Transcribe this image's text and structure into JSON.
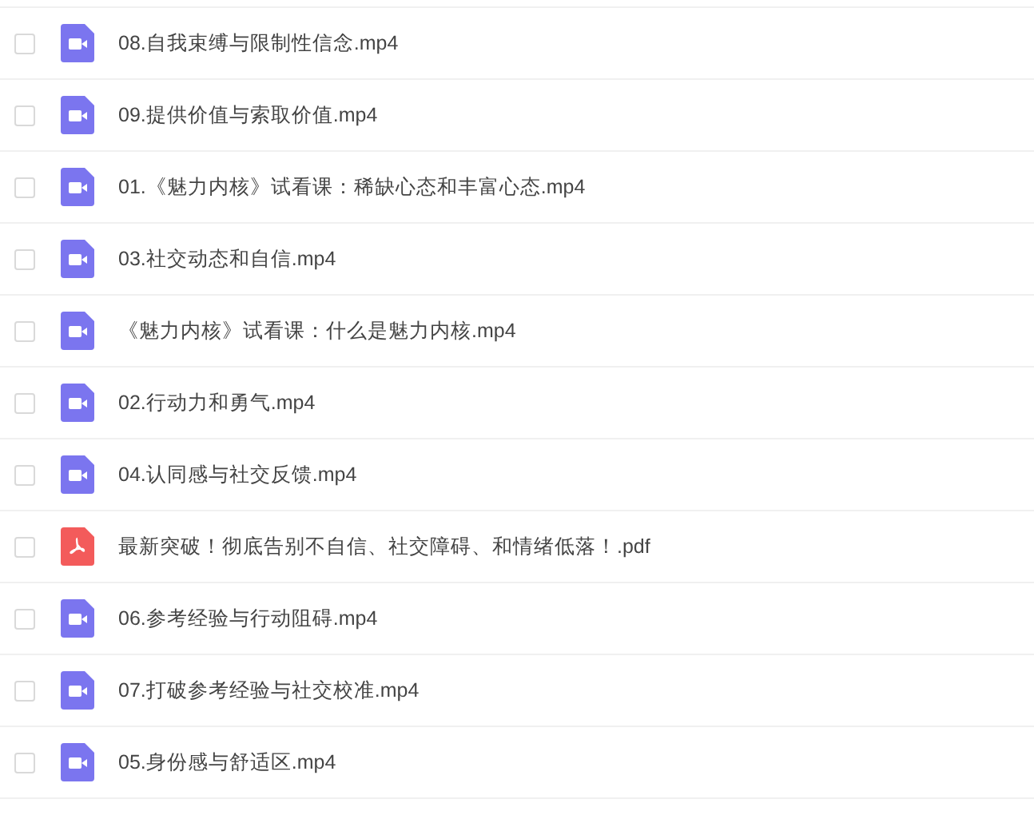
{
  "files": [
    {
      "name": "08.自我束缚与限制性信念.mp4",
      "kind": "video",
      "checked": false
    },
    {
      "name": "09.提供价值与索取价值.mp4",
      "kind": "video",
      "checked": false
    },
    {
      "name": "01.《魅力内核》试看课：稀缺心态和丰富心态.mp4",
      "kind": "video",
      "checked": false
    },
    {
      "name": "03.社交动态和自信.mp4",
      "kind": "video",
      "checked": false
    },
    {
      "name": "《魅力内核》试看课：什么是魅力内核.mp4",
      "kind": "video",
      "checked": false
    },
    {
      "name": "02.行动力和勇气.mp4",
      "kind": "video",
      "checked": false
    },
    {
      "name": "04.认同感与社交反馈.mp4",
      "kind": "video",
      "checked": false
    },
    {
      "name": "最新突破！彻底告别不自信、社交障碍、和情绪低落！.pdf",
      "kind": "pdf",
      "checked": false
    },
    {
      "name": "06.参考经验与行动阻碍.mp4",
      "kind": "video",
      "checked": false
    },
    {
      "name": "07.打破参考经验与社交校准.mp4",
      "kind": "video",
      "checked": false
    },
    {
      "name": "05.身份感与舒适区.mp4",
      "kind": "video",
      "checked": false
    }
  ]
}
